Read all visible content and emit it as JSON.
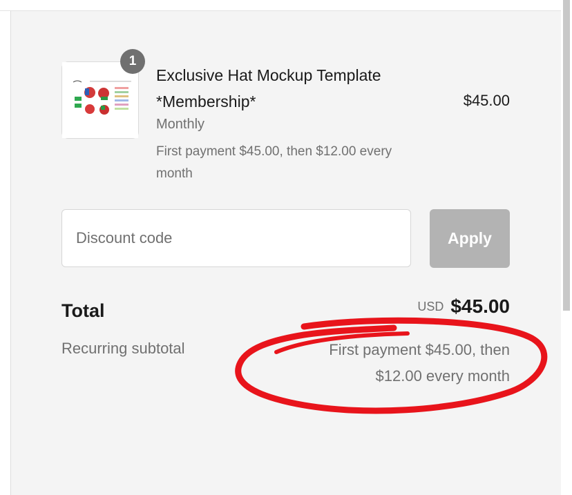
{
  "order_item": {
    "quantity": "1",
    "title": "Exclusive Hat Mockup Template *Membership*",
    "variant": "Monthly",
    "billing_note": "First payment $45.00, then $12.00 every month",
    "price": "$45.00"
  },
  "discount": {
    "placeholder": "Discount code",
    "apply_label": "Apply"
  },
  "summary": {
    "total_label": "Total",
    "currency": "USD",
    "total_amount": "$45.00",
    "recurring_label": "Recurring subtotal",
    "recurring_value": "First payment $45.00, then $12.00 every month"
  },
  "colors": {
    "panel_background": "#f4f4f4",
    "muted_text": "#707070",
    "apply_button": "#b3b3b3",
    "annotation": "#e8141b"
  }
}
